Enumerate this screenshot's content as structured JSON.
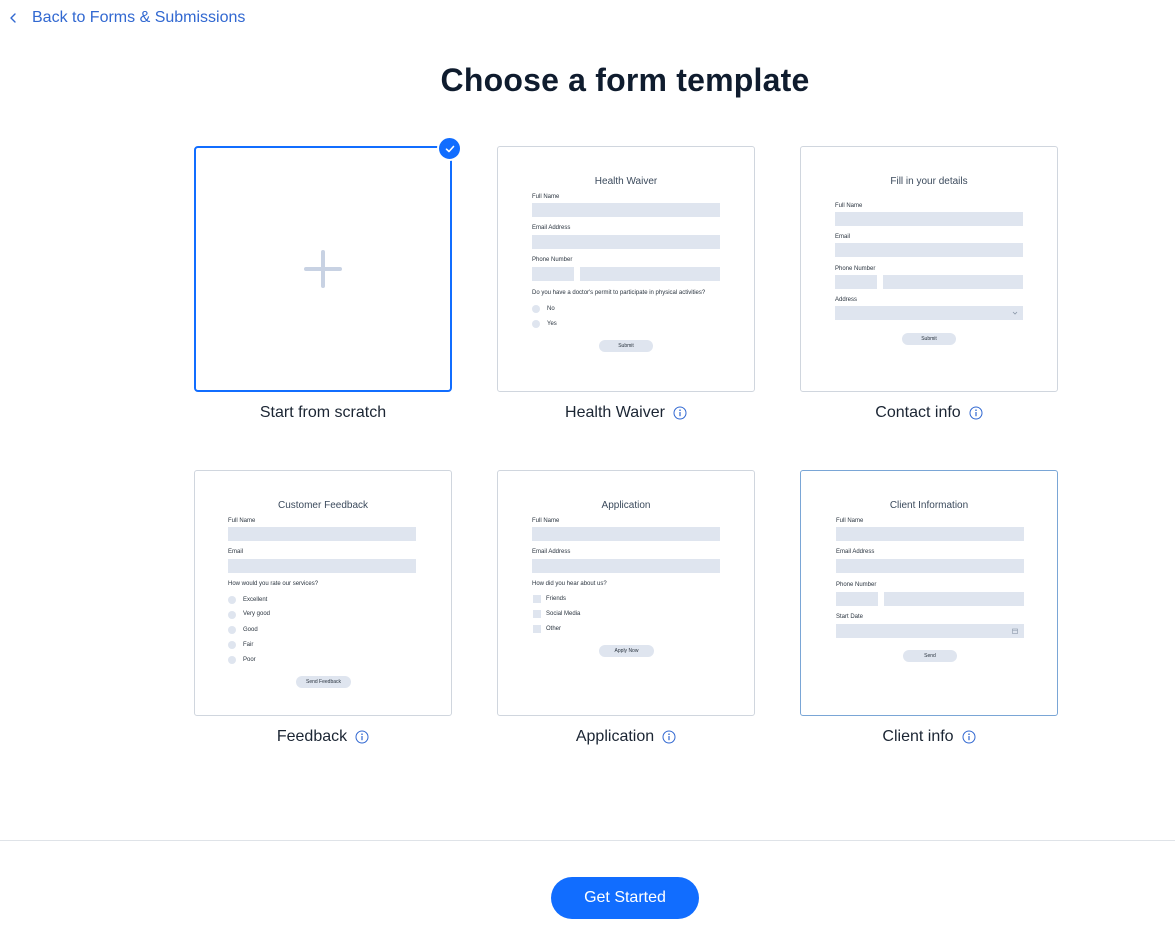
{
  "nav": {
    "back_label": "Back to Forms & Submissions"
  },
  "page": {
    "title": "Choose a form template"
  },
  "templates": {
    "scratch": {
      "caption": "Start from scratch"
    },
    "health": {
      "caption": "Health Waiver",
      "preview_title": "Health Waiver",
      "labels": [
        "Full Name",
        "Email Address",
        "Phone Number",
        "Do you have a doctor's permit to participate in physical activities?"
      ],
      "options": [
        "No",
        "Yes"
      ],
      "button": "Submit"
    },
    "contact": {
      "caption": "Contact info",
      "preview_title": "Fill in your details",
      "labels": [
        "Full Name",
        "Email",
        "Phone Number",
        "Address"
      ],
      "button": "Submit"
    },
    "feedback": {
      "caption": "Feedback",
      "preview_title": "Customer Feedback",
      "labels": [
        "Full Name",
        "Email",
        "How would you rate our services?"
      ],
      "options": [
        "Excellent",
        "Very good",
        "Good",
        "Fair",
        "Poor"
      ],
      "button": "Send Feedback"
    },
    "application": {
      "caption": "Application",
      "preview_title": "Application",
      "labels": [
        "Full Name",
        "Email Address",
        "How did you hear about us?"
      ],
      "options": [
        "Friends",
        "Social Media",
        "Other"
      ],
      "button": "Apply Now"
    },
    "client": {
      "caption": "Client info",
      "preview_title": "Client Information",
      "labels": [
        "Full Name",
        "Email Address",
        "Phone Number",
        "Start Date"
      ],
      "button": "Send"
    }
  },
  "footer": {
    "cta_label": "Get Started"
  },
  "colors": {
    "accent": "#116dff",
    "link": "#3168d1",
    "field": "#dfe5ef"
  }
}
